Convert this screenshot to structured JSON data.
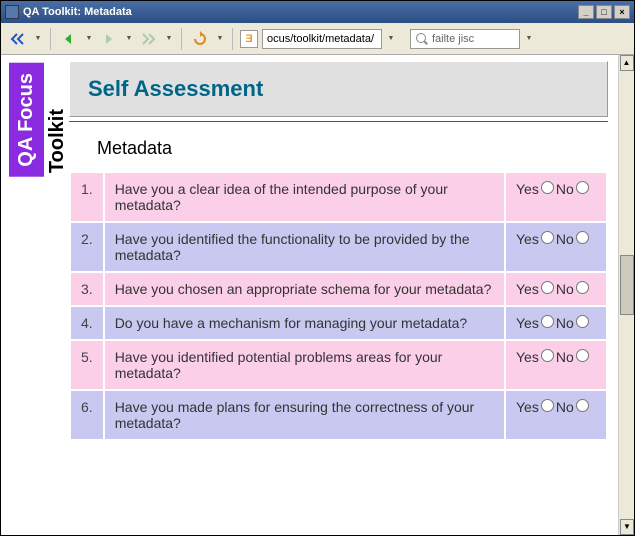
{
  "window": {
    "title": "QA Toolkit: Metadata"
  },
  "toolbar": {
    "url": "ocus/toolkit/metadata/",
    "search": "failte jisc"
  },
  "sidebar": {
    "brand": "QA Focus",
    "section": "Toolkit"
  },
  "page": {
    "heading": "Self Assessment",
    "subheading": "Metadata",
    "yes_label": "Yes",
    "no_label": "No",
    "questions": [
      {
        "num": "1.",
        "text": "Have you a clear idea of the intended purpose of your metadata?"
      },
      {
        "num": "2.",
        "text": "Have you identified the functionality to be provided by the metadata?"
      },
      {
        "num": "3.",
        "text": "Have you chosen an appropriate schema for your metadata?"
      },
      {
        "num": "4.",
        "text": "Do you have a mechanism for managing your metadata?"
      },
      {
        "num": "5.",
        "text": "Have you identified potential problems areas for your metadata?"
      },
      {
        "num": "6.",
        "text": "Have you made plans for ensuring the correctness of your metadata?"
      }
    ]
  }
}
